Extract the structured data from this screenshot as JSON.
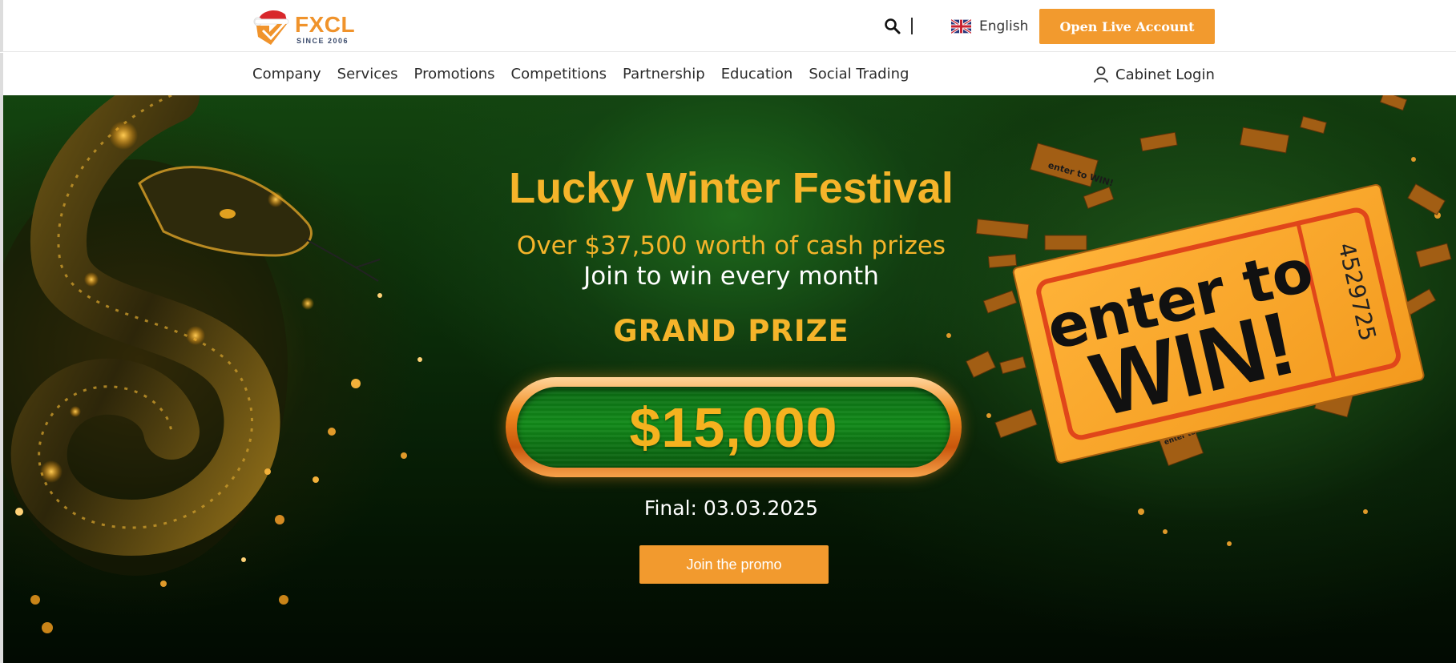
{
  "brand": {
    "logo_name": "FXCL",
    "logo_tagline": "SINCE 2006"
  },
  "header": {
    "search_icon": "search-icon",
    "language": "English",
    "open_account": "Open Live Account"
  },
  "nav": {
    "items": [
      {
        "label": "Company"
      },
      {
        "label": "Services"
      },
      {
        "label": "Promotions"
      },
      {
        "label": "Competitions"
      },
      {
        "label": "Partnership"
      },
      {
        "label": "Education"
      },
      {
        "label": "Social Trading"
      }
    ],
    "cabinet_login": "Cabinet Login"
  },
  "hero": {
    "title": "Lucky Winter Festival",
    "subtitle": "Over $37,500 worth of cash prizes",
    "subtitle2": "Join to win every month",
    "grand_label": "GRAND PRIZE",
    "prize_amount": "$15,000",
    "final_date": "Final: 03.03.2025",
    "cta": "Join the promo",
    "ticket_line1": "enter to",
    "ticket_line2": "WIN!",
    "ticket_number": "4529725",
    "mini_ticket_text": "enter to WIN!"
  },
  "colors": {
    "accent": "#f29a2e",
    "gold_text": "#f5b42a",
    "hero_green": "#13440f"
  }
}
